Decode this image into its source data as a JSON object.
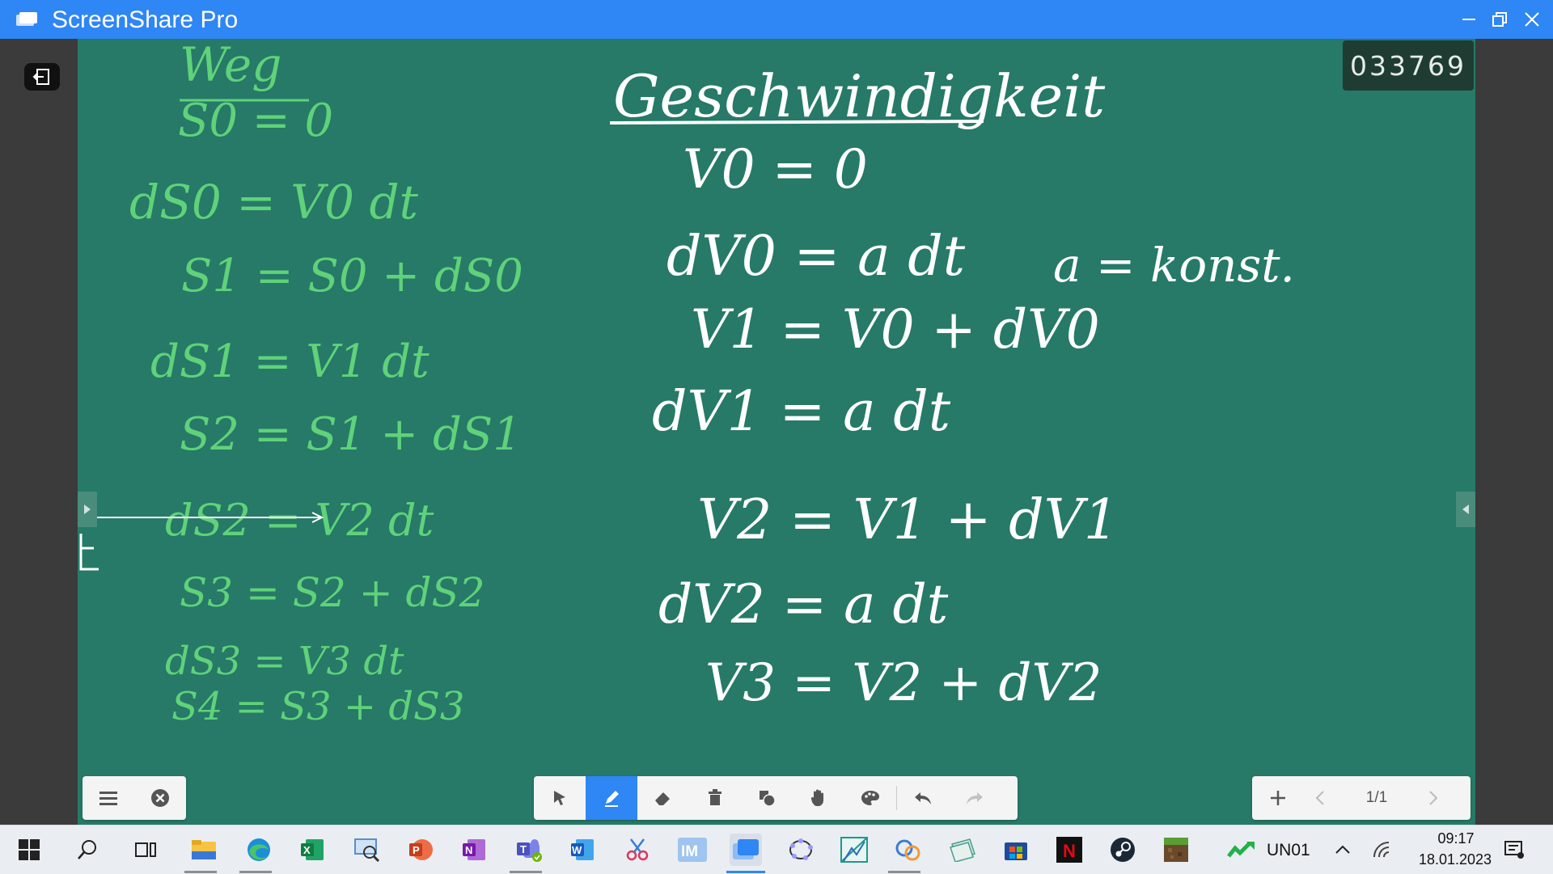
{
  "window": {
    "title": "ScreenShare Pro"
  },
  "board": {
    "code": "033769",
    "left_column": {
      "heading": "Weg",
      "lines": [
        "S0 = 0",
        "dS0 = V0 dt",
        "S1 = S0 + dS0",
        "dS1 = V1 dt",
        "S2 = S1 + dS1",
        "dS2 = V2 dt",
        "S3 = S2 + dS2",
        "dS3 = V3 dt",
        "S4 = S3 + dS3"
      ]
    },
    "center_column": {
      "heading": "Geschwindigkeit",
      "lines": [
        "V0 = 0",
        "dV0 = a dt",
        "V1 = V0 + dV0",
        "dV1 = a dt",
        "V2 = V1 + dV1",
        "dV2 = a dt",
        "V3 = V2 + dV2"
      ]
    },
    "note": "a = konst.",
    "colors": {
      "background": "#267a67",
      "chalk_white": "#ffffff",
      "chalk_green": "#5fd27a"
    }
  },
  "toolbar_left": {
    "icons": [
      "menu-icon",
      "close-icon"
    ]
  },
  "toolbar_center": {
    "tools": [
      "select-icon",
      "pen-icon",
      "eraser-icon",
      "trash-icon",
      "shapes-icon",
      "hand-icon",
      "palette-icon",
      "undo-icon",
      "redo-icon"
    ],
    "active_tool": "pen-icon"
  },
  "toolbar_right": {
    "page_indicator": "1/1"
  },
  "taskbar": {
    "apps": [
      "start",
      "search",
      "task-view",
      "file-explorer",
      "edge",
      "excel",
      "magnifier",
      "powerpoint",
      "onenote",
      "teams",
      "word",
      "snipping-tool",
      "im",
      "screenshare-pro",
      "geogebra",
      "geometry",
      "photo-app",
      "paper-app",
      "store",
      "netflix",
      "steam",
      "minecraft"
    ],
    "tray_label": "UN01",
    "time": "09:17",
    "date": "18.01.2023"
  }
}
